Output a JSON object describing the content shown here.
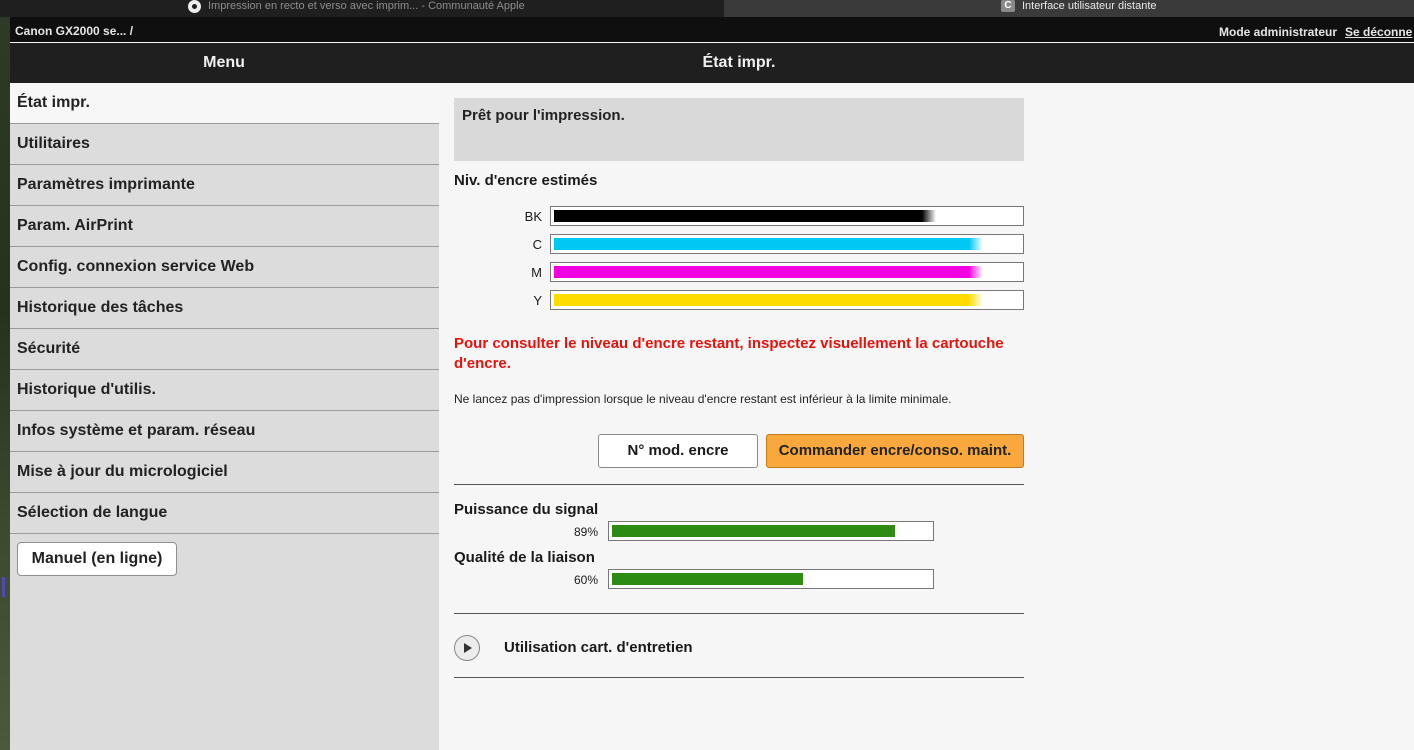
{
  "browser": {
    "tabs": [
      {
        "title": "Impression en recto et verso avec imprim... - Communauté Apple"
      },
      {
        "title": "Interface utilisateur distante",
        "icon_letter": "C"
      }
    ]
  },
  "topbar": {
    "breadcrumb": "Canon GX2000 se... /",
    "mode": "Mode administrateur",
    "logout": "Se déconne"
  },
  "header": {
    "menu_title": "Menu",
    "page_title": "État impr."
  },
  "sidebar": {
    "items": [
      {
        "label": "État impr."
      },
      {
        "label": "Utilitaires"
      },
      {
        "label": "Paramètres imprimante"
      },
      {
        "label": "Param. AirPrint"
      },
      {
        "label": "Config. connexion service Web"
      },
      {
        "label": "Historique des tâches"
      },
      {
        "label": "Sécurité"
      },
      {
        "label": "Historique d'utilis."
      },
      {
        "label": "Infos système et param. réseau"
      },
      {
        "label": "Mise à jour du micrologiciel"
      },
      {
        "label": "Sélection de langue"
      }
    ],
    "manual_button": "Manuel (en ligne)"
  },
  "main": {
    "status": "Prêt pour l'impression.",
    "ink_title": "Niv. d'encre estimés",
    "inks": [
      {
        "label": "BK",
        "color": "#000000",
        "level": 0.82
      },
      {
        "label": "C",
        "color": "#00c8f5",
        "level": 0.92
      },
      {
        "label": "M",
        "color": "#f000e0",
        "level": 0.92
      },
      {
        "label": "Y",
        "color": "#ffdc00",
        "level": 0.92
      }
    ],
    "warning": "Pour consulter le niveau d'encre restant, inspectez visuellement la cartouche d'encre.",
    "note": "Ne lancez pas d'impression lorsque le niveau d'encre restant est inférieur à la limite minimale.",
    "model_button": "N° mod. encre",
    "order_button": "Commander encre/conso. maint.",
    "signal": {
      "title": "Puissance du signal",
      "percent": "89%",
      "level": 0.89
    },
    "link": {
      "title": "Qualité de la liaison",
      "percent": "60%",
      "level": 0.6
    },
    "maintenance": "Utilisation cart. d'entretien"
  }
}
